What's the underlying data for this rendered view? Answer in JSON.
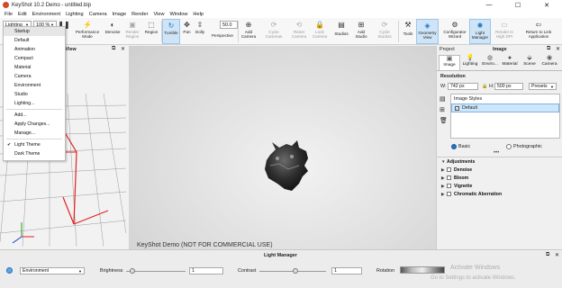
{
  "window": {
    "title": "KeyShot 10.2 Demo  -  untitled.bip",
    "minimize": "—",
    "maximize": "☐",
    "close": "✕"
  },
  "menu": [
    "File",
    "Edit",
    "Environment",
    "Lighting",
    "Camera",
    "Image",
    "Render",
    "View",
    "Window",
    "Help"
  ],
  "toolbar": {
    "preset_value": "Lighting",
    "zoom_value": "100 %",
    "fps_value": "50.0",
    "buttons": [
      {
        "label": "Performance Mode",
        "icon": "performance-icon"
      },
      {
        "label": "Denoise",
        "icon": "denoise-icon"
      },
      {
        "label": "Render Region",
        "icon": "render-region-icon"
      },
      {
        "label": "Region",
        "icon": "region-icon"
      },
      {
        "label": "Tumble",
        "icon": "tumble-icon"
      },
      {
        "label": "Pan",
        "icon": "pan-icon"
      },
      {
        "label": "Dolly",
        "icon": "dolly-icon"
      },
      {
        "label": "Perspective",
        "icon": "perspective-icon"
      },
      {
        "label": "Add Camera",
        "icon": "add-camera-icon"
      },
      {
        "label": "Cycle Cameras",
        "icon": "cycle-cameras-icon"
      },
      {
        "label": "Reset Camera",
        "icon": "reset-camera-icon"
      },
      {
        "label": "Lock Camera",
        "icon": "lock-camera-icon"
      },
      {
        "label": "Studios",
        "icon": "studios-icon"
      },
      {
        "label": "Add Studio",
        "icon": "add-studio-icon"
      },
      {
        "label": "Cycle Studios",
        "icon": "cycle-studios-icon"
      },
      {
        "label": "Tools",
        "icon": "tools-icon"
      },
      {
        "label": "Geometry View",
        "icon": "geometry-view-icon"
      },
      {
        "label": "Configurator Wizard",
        "icon": "configurator-icon"
      },
      {
        "label": "Light Manager",
        "icon": "light-manager-icon"
      },
      {
        "label": "Render in High DPI",
        "icon": "high-dpi-icon"
      },
      {
        "label": "Return to Link Application",
        "icon": "link-app-icon"
      }
    ]
  },
  "dropdown": {
    "items": [
      "Startup",
      "Default",
      "Animation",
      "Compact",
      "Material",
      "Camera",
      "Environment",
      "Studio",
      "Lighting...",
      "Add...",
      "Apply Changes...",
      "Manage...",
      "Light Theme",
      "Dark Theme"
    ],
    "checked": "Light Theme"
  },
  "geometry_view": {
    "title_suffix": "y View"
  },
  "viewport": {
    "watermark": "KeyShot Demo (NOT FOR COMMERCIAL USE)"
  },
  "right_panel": {
    "header_left": "Project",
    "header_right": "Image",
    "tabs": [
      "Image",
      "Lighting",
      "Enviro...",
      "Material",
      "Scene",
      "Camera"
    ],
    "resolution_label": "Resolution",
    "w_label": "W:",
    "w_value": "742 px",
    "h_label": "H:",
    "h_value": "500 px",
    "presets_label": "Presets",
    "image_styles_label": "Image Styles",
    "style_default": "Default",
    "mode_basic": "Basic",
    "mode_photographic": "Photographic",
    "adjustments_label": "Adjustments",
    "adjustments": [
      "Denoise",
      "Bloom",
      "Vignette",
      "Chromatic Aberration"
    ]
  },
  "light_manager": {
    "title": "Light Manager",
    "environment_value": "Environment",
    "brightness_label": "Brightness",
    "brightness_value": "1",
    "contrast_label": "Contrast",
    "contrast_value": "1",
    "rotation_label": "Rotation"
  },
  "activation": {
    "title": "Activate Windows",
    "subtitle": "Go to Settings to activate Windows."
  },
  "colors": {
    "accent": "#1e74c8",
    "axis_red": "#e02020",
    "axis_green": "#1aa31a",
    "axis_blue": "#1a3ad0"
  }
}
